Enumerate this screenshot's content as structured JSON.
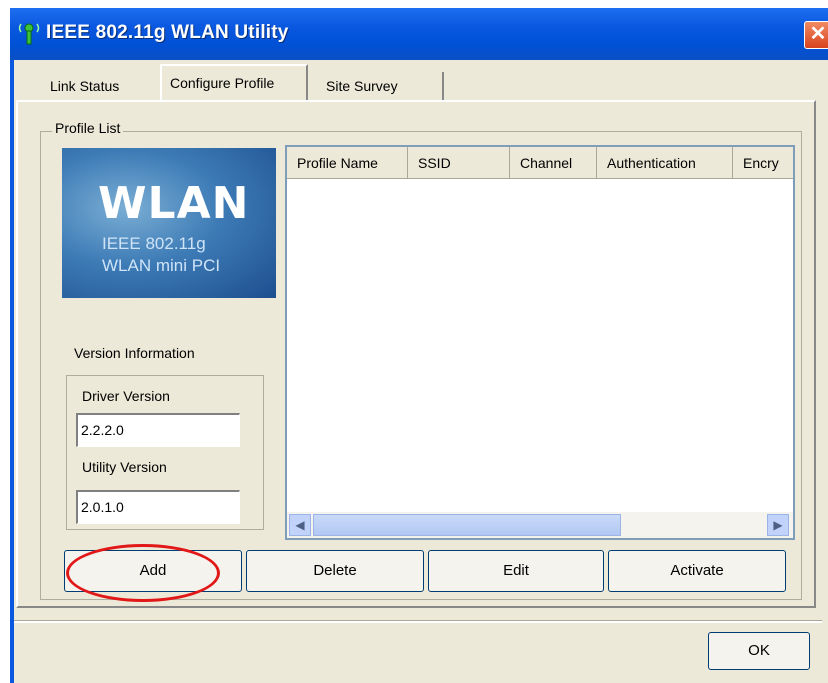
{
  "window": {
    "title": "IEEE 802.11g WLAN Utility",
    "close_glyph": "✕"
  },
  "tabs": [
    {
      "label": "Link Status",
      "active": false
    },
    {
      "label": "Configure Profile",
      "active": true
    },
    {
      "label": "Site Survey",
      "active": false
    }
  ],
  "profile_list": {
    "group_label": "Profile List",
    "columns": [
      "Profile Name",
      "SSID",
      "Channel",
      "Authentication",
      "Encry"
    ],
    "rows": []
  },
  "logo": {
    "big": "WLAN",
    "line1": "IEEE 802.11g",
    "line2": "WLAN mini PCI"
  },
  "version": {
    "title": "Version Information",
    "driver_label": "Driver Version",
    "driver_value": "2.2.2.0",
    "utility_label": "Utility Version",
    "utility_value": "2.0.1.0"
  },
  "buttons": {
    "add": "Add",
    "delete": "Delete",
    "edit": "Edit",
    "activate": "Activate",
    "ok": "OK"
  },
  "colors": {
    "title_bar": "#0a58e0",
    "highlight_ring": "#e21717",
    "dialog_bg": "#ece9d8"
  }
}
